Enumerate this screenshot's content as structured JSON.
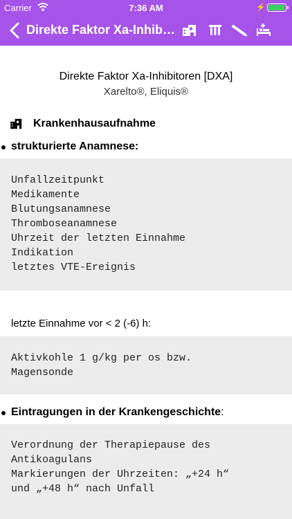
{
  "status_bar": {
    "carrier": "Carrier",
    "time": "7:36 AM"
  },
  "nav": {
    "title": "Direkte Faktor Xa-Inhibit...",
    "icons": [
      "back-chevron-icon",
      "hospital-icon",
      "test-tubes-icon",
      "syringe-icon",
      "bed-icon"
    ]
  },
  "document": {
    "title": "Direkte Faktor Xa-Inhibitoren [DXA]",
    "subtitle": "Xarelto®, Eliquis®"
  },
  "section": {
    "heading": "Krankenhausaufnahme",
    "icon": "hospital-icon"
  },
  "anamnesis": {
    "label": "strukturierte Anamnese:",
    "items": [
      "Unfallzeitpunkt",
      "Medikamente",
      "Blutungsanamnese",
      "Thromboseanamnese",
      "Uhrzeit der letzten Einnahme",
      "Indikation",
      "letztes VTE-Ereignis"
    ]
  },
  "last_intake": {
    "text": "letzte Einnahme vor < 2 (-6) h:",
    "items": [
      "Aktivkohle 1 g/kg per os bzw.",
      "Magensonde"
    ]
  },
  "records": {
    "label": "Eintragungen in der Krankengeschichte",
    "suffix": ":",
    "items": [
      "Verordnung der Therapiepause des",
      "Antikoagulans",
      "Markierungen der Uhrzeiten: „+24 h“",
      "und „+48 h“ nach Unfall"
    ]
  },
  "colors": {
    "accent": "#a553e8",
    "code_background": "#ececec",
    "battery": "#3ad35a"
  }
}
